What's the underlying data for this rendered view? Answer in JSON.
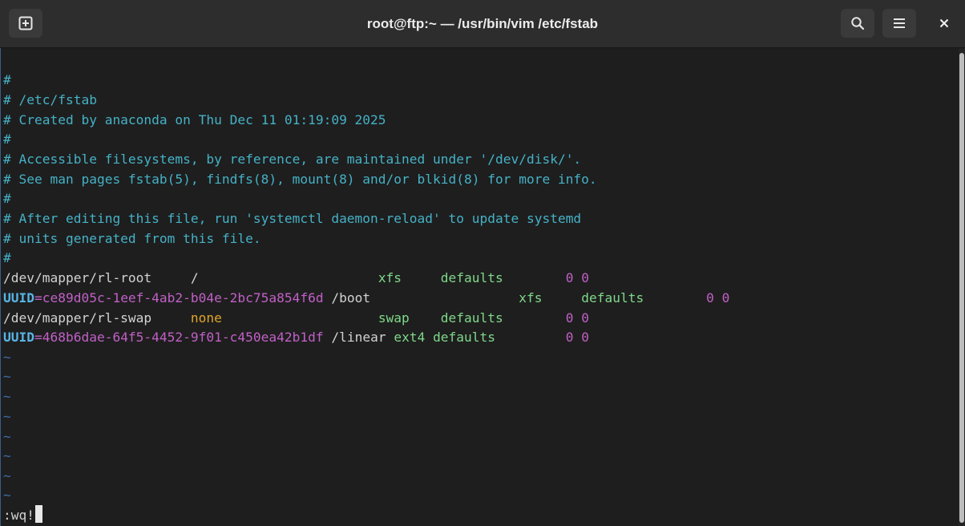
{
  "window": {
    "title": "root@ftp:~ — /usr/bin/vim /etc/fstab",
    "buttons": {
      "new_tab_icon": "new-tab-icon",
      "search_icon": "search-icon",
      "menu_icon": "hamburger-menu-icon",
      "close_icon": "close-icon"
    }
  },
  "colors": {
    "comment": "#45b1c6",
    "text": "#d2d2d2",
    "filesystem_type": "#7fd88a",
    "number": "#c160c6",
    "special": "#e0a42a",
    "uuid_key": "#58b5e6",
    "tilde": "#3d6ea8",
    "background": "#1e1e1e",
    "titlebar": "#2d2d2d"
  },
  "editor": {
    "comments": [
      "#",
      "# /etc/fstab",
      "# Created by anaconda on Thu Dec 11 01:19:09 2025",
      "#",
      "# Accessible filesystems, by reference, are maintained under '/dev/disk/'.",
      "# See man pages fstab(5), findfs(8), mount(8) and/or blkid(8) for more info.",
      "#",
      "# After editing this file, run 'systemctl daemon-reload' to update systemd",
      "# units generated from this file.",
      "#"
    ],
    "entries": [
      {
        "device": "/dev/mapper/rl-root",
        "sep1": "     ",
        "mount": "/",
        "sep2": "                       ",
        "fstype": "xfs",
        "sep3": "     ",
        "options": "defaults",
        "sep4": "        ",
        "dump_pass": "0 0"
      },
      {
        "device_key": "UUID",
        "device_eq": "=",
        "device_val": "ce89d05c-1eef-4ab2-b04e-2bc75a854f6d",
        "sep1": " ",
        "mount": "/boot",
        "sep2": "                   ",
        "fstype": "xfs",
        "sep3": "     ",
        "options": "defaults",
        "sep4": "        ",
        "dump_pass": "0 0"
      },
      {
        "device": "/dev/mapper/rl-swap",
        "sep1": "     ",
        "mount": "none",
        "sep2": "                    ",
        "fstype": "swap",
        "sep3": "    ",
        "options": "defaults",
        "sep4": "        ",
        "dump_pass": "0 0"
      },
      {
        "device_key": "UUID",
        "device_eq": "=",
        "device_val": "468b6dae-64f5-4452-9f01-c450ea42b1df",
        "sep1": " ",
        "mount": "/linear",
        "sep2": " ",
        "fstype": "ext4",
        "sep3": " ",
        "options": "defaults",
        "sep4": "         ",
        "dump_pass": "0 0"
      }
    ],
    "empty_line_marker": "~",
    "empty_lines": [
      "~",
      "~",
      "~",
      "~",
      "~",
      "~",
      "~",
      "~"
    ],
    "command_line": ":wq!"
  }
}
